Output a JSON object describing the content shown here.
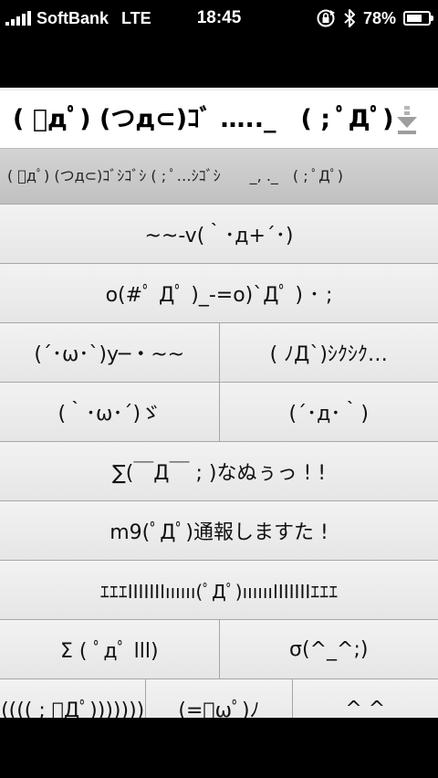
{
  "status_bar": {
    "carrier": "SoftBank",
    "network": "LTE",
    "time": "18:45",
    "battery_percent": "78%",
    "battery_level": 0.78,
    "icons": [
      "signal-bars-icon",
      "rotation-lock-icon",
      "bluetooth-icon",
      "battery-icon"
    ]
  },
  "header": {
    "text": "( ﾟдﾟ) (つд⊂)ｺﾞ ….._　( ; ﾟДﾟ)",
    "arrow_icon": "down-arrow-icon"
  },
  "banner": {
    "text": "( ﾟдﾟ) (つд⊂)ｺﾞｼｺﾞｼ ( ; ﾟ…ｼｺﾞｼ　　_, ._　( ; ﾟДﾟ)"
  },
  "rows": [
    [
      {
        "label": "~~-v(｀･д+´･)"
      }
    ],
    [
      {
        "label": "o(#ﾟ Дﾟ )_-=o)`Дﾟ ) ･ ;"
      }
    ],
    [
      {
        "label": "(´･ω･`)y─・~~"
      },
      {
        "label": "( ﾉД`)ｼｸｼｸ…"
      }
    ],
    [
      {
        "label": "(｀･ω･´)ゞ"
      },
      {
        "label": "(´･д･｀)"
      }
    ],
    [
      {
        "label": "∑(￣Д￣ ; )なぬぅっ ! !"
      }
    ],
    [
      {
        "label": "m9(ﾟДﾟ)通報しますた !"
      }
    ],
    [
      {
        "label": "ｴｴｴIIIIIIIıııııı(ﾟДﾟ)ııııııIIIIIIIｴｴｴ"
      }
    ],
    [
      {
        "label": "Σ ( ﾟдﾟ lll)"
      },
      {
        "label": "σ(^_^;)"
      }
    ],
    [
      {
        "label": "(((( ; ﾟДﾟ)))))))"
      },
      {
        "label": "(=ﾟωﾟ)ﾉ"
      },
      {
        "label": "^ ^"
      }
    ]
  ]
}
